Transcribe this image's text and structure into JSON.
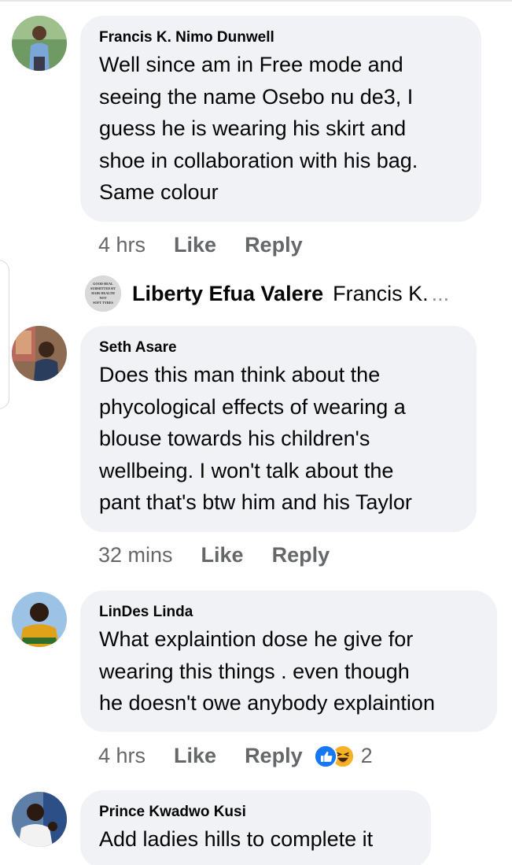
{
  "comments": [
    {
      "author": "Francis K. Nimo Dunwell",
      "lines": [
        "Well since am in Free mode and",
        "seeing the name Osebo nu de3, I",
        "guess he is wearing his skirt and",
        "shoe in collaboration with his bag.",
        "Same colour"
      ],
      "time": "4 hrs",
      "like": "Like",
      "reply": "Reply"
    },
    {
      "author": "Seth Asare",
      "lines": [
        "Does this man think about the",
        "phycological effects of wearing a",
        "blouse towards his children's",
        "wellbeing. I won't talk about the",
        "pant that's btw him and his Taylor"
      ],
      "time": "32 mins",
      "like": "Like",
      "reply": "Reply"
    },
    {
      "author": "LinDes Linda",
      "lines": [
        "What explaintion dose he give for",
        "wearing this things . even though",
        "he doesn't owe anybody explaintion"
      ],
      "time": "4 hrs",
      "like": "Like",
      "reply": "Reply",
      "reaction_count": "2",
      "reactions": [
        "like-icon",
        "haha-icon"
      ]
    },
    {
      "author": "Prince Kwadwo Kusi",
      "lines": [
        "Add ladies hills to complete it"
      ]
    }
  ],
  "reply_preview": {
    "author": "Liberty Efua Valere",
    "text": "Francis K.",
    "ellipsis": "...",
    "avatar_text": [
      "GOOD HEAL",
      "SUBMITTED BY",
      "HAIR HEALTH",
      "NOT",
      "SOFT TYRES"
    ]
  },
  "colors": {
    "bubble": "#f0f2f5",
    "meta": "#65676b",
    "like_blue": "#1877f2",
    "haha_yellow": "#f7b125"
  }
}
